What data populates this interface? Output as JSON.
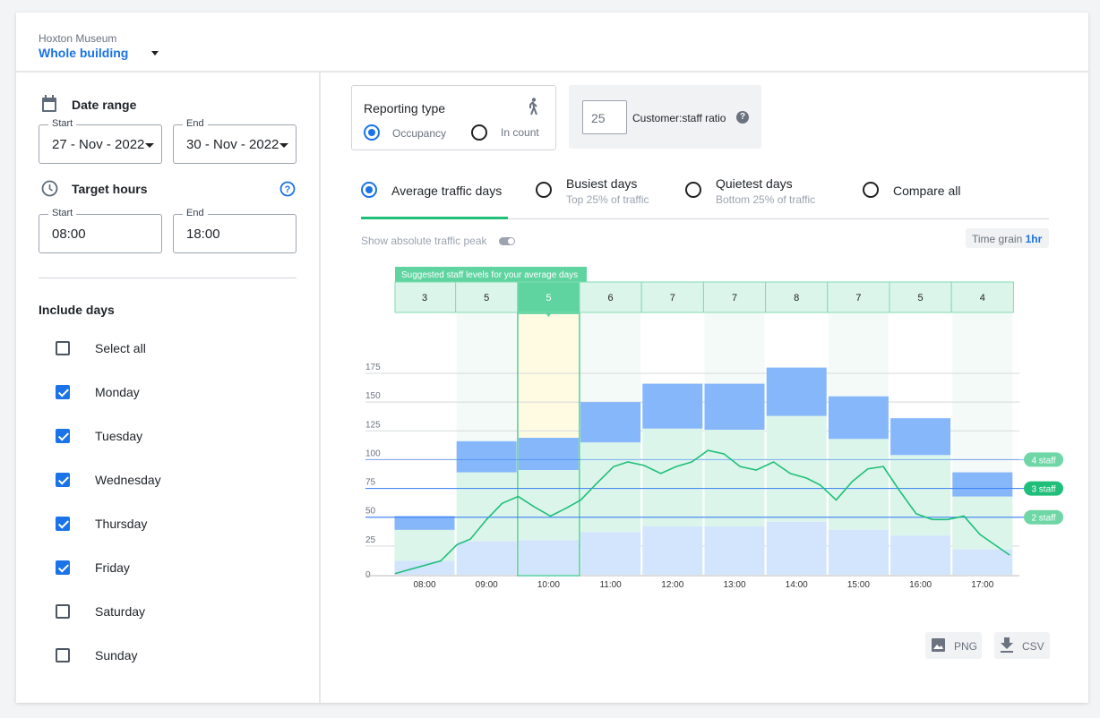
{
  "header": {
    "org": "Hoxton Museum",
    "location": "Whole building"
  },
  "sidebar": {
    "date_range": {
      "title": "Date range",
      "start_label": "Start",
      "start": "27 - Nov - 2022",
      "end_label": "End",
      "end": "30 - Nov - 2022"
    },
    "target_hours": {
      "title": "Target hours",
      "start_label": "Start",
      "start": "08:00",
      "end_label": "End",
      "end": "18:00"
    },
    "include_days": {
      "title": "Include days",
      "items": [
        {
          "label": "Select all",
          "checked": false
        },
        {
          "label": "Monday",
          "checked": true
        },
        {
          "label": "Tuesday",
          "checked": true
        },
        {
          "label": "Wednesday",
          "checked": true
        },
        {
          "label": "Thursday",
          "checked": true
        },
        {
          "label": "Friday",
          "checked": true
        },
        {
          "label": "Saturday",
          "checked": false
        },
        {
          "label": "Sunday",
          "checked": false
        }
      ]
    }
  },
  "reporting": {
    "title": "Reporting type",
    "options": [
      "Occupancy",
      "In count"
    ],
    "selected": "Occupancy"
  },
  "ratio": {
    "value": "25",
    "label": "Customer:staff ratio"
  },
  "tabs": [
    {
      "label": "Average traffic days",
      "sub": "",
      "selected": true
    },
    {
      "label": "Busiest days",
      "sub": "Top 25% of traffic",
      "selected": false
    },
    {
      "label": "Quietest days",
      "sub": "Bottom 25% of traffic",
      "selected": false
    },
    {
      "label": "Compare all",
      "sub": "",
      "selected": false
    }
  ],
  "toggle": {
    "label": "Show absolute traffic peak",
    "on": false
  },
  "time_grain": {
    "label": "Time grain",
    "value": "1hr"
  },
  "export": {
    "png": "PNG",
    "csv": "CSV"
  },
  "colors": {
    "accent": "#1a73e8",
    "green": "#1fbf7a",
    "range_bar": "#86b7fb",
    "mid_bar": "#dcf5ea",
    "low_bar": "#d3e4fd",
    "selected_col": "#fffbe3"
  },
  "chart_data": {
    "type": "bar",
    "staff_title": "Suggested staff levels for your average days",
    "categories": [
      "08:00",
      "09:00",
      "10:00",
      "11:00",
      "12:00",
      "13:00",
      "14:00",
      "15:00",
      "16:00",
      "17:00"
    ],
    "suggested_staff": [
      3,
      5,
      5,
      6,
      7,
      7,
      8,
      7,
      5,
      4
    ],
    "selected_category": "10:00",
    "series": [
      {
        "values_low": [
          12,
          29,
          30,
          37,
          42,
          42,
          46,
          39,
          34,
          22
        ]
      },
      {
        "values_mid": [
          39,
          89,
          91,
          115,
          127,
          126,
          138,
          118,
          104,
          68
        ]
      },
      {
        "values_high": [
          51,
          116,
          119,
          150,
          166,
          166,
          180,
          155,
          136,
          89
        ]
      }
    ],
    "line": {
      "x": [
        7.52,
        8.26,
        8.52,
        8.74,
        9.0,
        9.25,
        9.51,
        9.77,
        10.03,
        10.29,
        10.52,
        10.77,
        11.05,
        11.28,
        11.54,
        11.81,
        12.06,
        12.31,
        12.57,
        12.83,
        13.09,
        13.35,
        13.63,
        13.9,
        14.16,
        14.38,
        14.64,
        14.9,
        15.15,
        15.4,
        15.65,
        15.93,
        16.19,
        16.44,
        16.7,
        16.96,
        17.44
      ],
      "y": [
        1,
        12,
        26,
        31,
        48,
        62,
        68,
        59,
        51,
        58,
        65,
        79,
        94,
        98,
        95,
        88,
        94,
        98,
        108,
        105,
        94,
        91,
        98,
        88,
        84,
        78,
        65,
        81,
        92,
        94,
        74,
        53,
        48,
        48,
        51,
        35,
        17
      ]
    },
    "thresholds": [
      {
        "label": "4 staff",
        "value": 100
      },
      {
        "label": "3 staff",
        "value": 75
      },
      {
        "label": "2 staff",
        "value": 50
      }
    ],
    "yticks": [
      0,
      25,
      50,
      75,
      100,
      125,
      150,
      175
    ],
    "ylim": [
      0,
      200
    ],
    "grid": true
  }
}
